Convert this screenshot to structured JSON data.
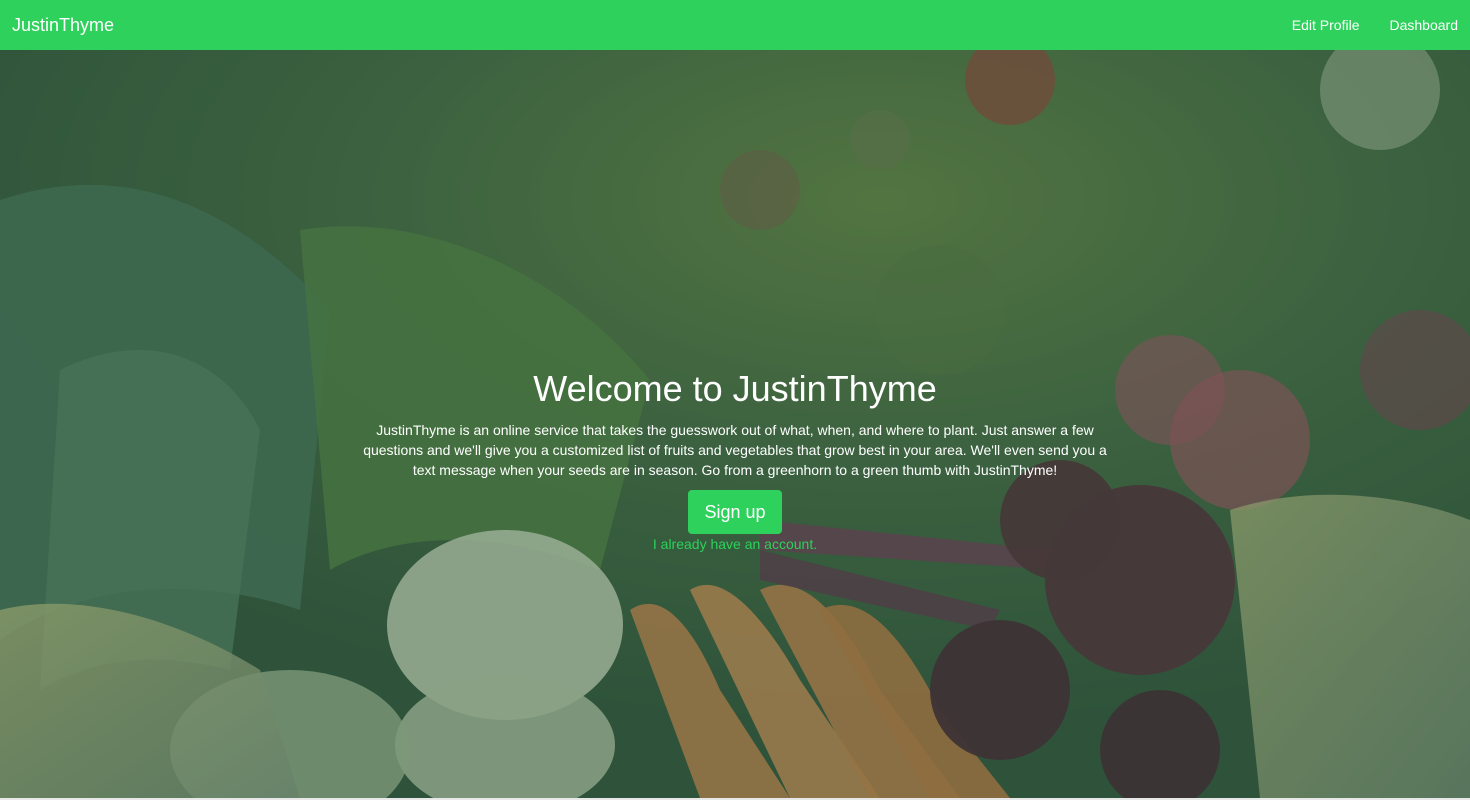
{
  "navbar": {
    "brand": "JustinThyme",
    "links": [
      "Edit Profile",
      "Dashboard"
    ]
  },
  "hero": {
    "title": "Welcome to JustinThyme",
    "description": "JustinThyme is an online service that takes the guesswork out of what, when, and where to plant. Just answer a few questions and we'll give you a customized list of fruits and vegetables that grow best in your area. We'll even send you a text message when your seeds are in season. Go from a greenhorn to a green thumb with JustinThyme!",
    "signup_label": "Sign up",
    "login_link": "I already have an account.",
    "background": "vegetables-basket-photo"
  },
  "colors": {
    "accent": "#2dd15b",
    "text_on_hero": "#ffffff"
  }
}
